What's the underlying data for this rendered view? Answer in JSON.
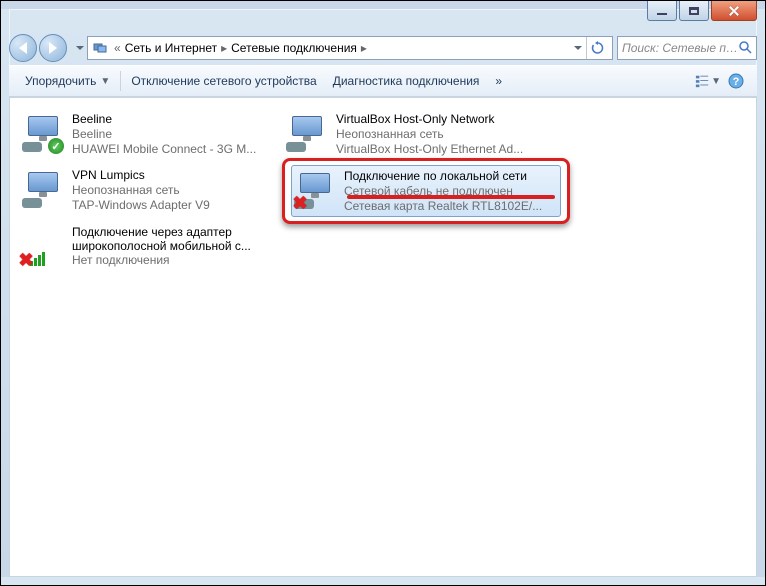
{
  "window": {
    "min_tooltip": "Свернуть",
    "max_tooltip": "Развернуть",
    "close_tooltip": "Закрыть"
  },
  "breadcrumb": {
    "level1": "Сеть и Интернет",
    "level2": "Сетевые подключения"
  },
  "search": {
    "placeholder": "Поиск: Сетевые подключения"
  },
  "toolbar": {
    "organize": "Упорядочить",
    "disable": "Отключение сетевого устройства",
    "diagnose": "Диагностика подключения",
    "more": "»"
  },
  "connections": [
    {
      "name": "Beeline",
      "status": "Beeline",
      "device": "HUAWEI Mobile Connect - 3G M...",
      "icon": "modem",
      "badge": "ok"
    },
    {
      "name": "VirtualBox Host-Only Network",
      "status": "Неопознанная сеть",
      "device": "VirtualBox Host-Only Ethernet Ad...",
      "icon": "lan",
      "badge": "none"
    },
    {
      "name": "VPN Lumpics",
      "status": "Неопознанная сеть",
      "device": "TAP-Windows Adapter V9",
      "icon": "lan",
      "badge": "none"
    },
    {
      "name": "Подключение по локальной сети",
      "status": "Сетевой кабель не подключен",
      "device": "Сетевая карта Realtek RTL8102E/...",
      "icon": "lan",
      "badge": "x",
      "selected": true
    },
    {
      "name": "Подключение через адаптер широкополосной мобильной с...",
      "status": "Нет подключения",
      "device": "",
      "icon": "wifi",
      "badge": "x"
    }
  ]
}
